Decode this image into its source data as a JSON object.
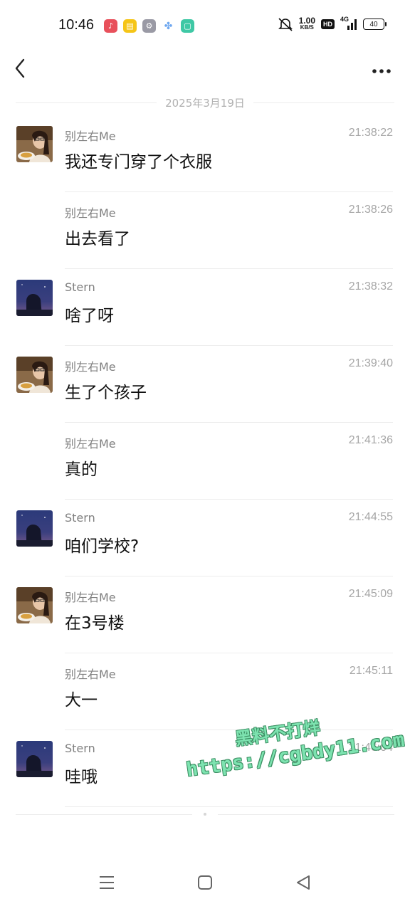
{
  "status_bar": {
    "time": "10:46",
    "apps": [
      {
        "icon": "music-app-icon",
        "color": "#e8505b"
      },
      {
        "icon": "notes-app-icon",
        "color": "#f5c518"
      },
      {
        "icon": "settings-app-icon",
        "color": "#9a9aa5"
      },
      {
        "icon": "pinwheel-app-icon",
        "color": "#6fa8f0"
      },
      {
        "icon": "chat-app-icon",
        "color": "#3fc8a5"
      }
    ],
    "network_speed": "1.00",
    "network_unit": "KB/S",
    "hd_label": "HD",
    "network_type": "4G",
    "battery": "40"
  },
  "header": {
    "back_icon": "chevron-left-icon",
    "more_icon": "more-horizontal-icon"
  },
  "date_divider": "2025年3月19日",
  "messages": [
    {
      "sender": "别左右Me",
      "time": "21:38:22",
      "content": "我还专门穿了个衣服",
      "avatar": "girl"
    },
    {
      "sender": "别左右Me",
      "time": "21:38:26",
      "content": "出去看了",
      "avatar": ""
    },
    {
      "sender": "Stern",
      "time": "21:38:32",
      "content": "啥了呀",
      "avatar": "night"
    },
    {
      "sender": "别左右Me",
      "time": "21:39:40",
      "content": "生了个孩子",
      "avatar": "girl"
    },
    {
      "sender": "别左右Me",
      "time": "21:41:36",
      "content": "真的",
      "avatar": ""
    },
    {
      "sender": "Stern",
      "time": "21:44:55",
      "content": "咱们学校?",
      "avatar": "night"
    },
    {
      "sender": "别左右Me",
      "time": "21:45:09",
      "content": "在3号楼",
      "avatar": "girl"
    },
    {
      "sender": "别左右Me",
      "time": "21:45:11",
      "content": "大一",
      "avatar": ""
    },
    {
      "sender": "Stern",
      "time": "21:46:04",
      "content": "哇哦",
      "avatar": "night"
    }
  ],
  "watermark": {
    "line1": "黑料不打烊",
    "line2": "https://cgbdy11.com"
  },
  "nav_bar": {
    "menu_icon": "menu-icon",
    "home_icon": "home-square-icon",
    "back_icon": "back-triangle-icon"
  }
}
